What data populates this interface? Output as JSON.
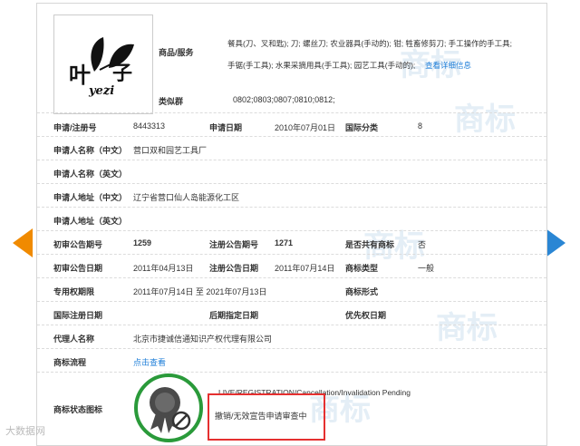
{
  "logo": {
    "chinese_left": "叶",
    "chinese_right": "子",
    "latin": "yezi"
  },
  "goods": {
    "label": "商品/服务",
    "line1": "餐具(刀、叉和匙); 刀; 螺丝刀; 农业器具(手动的); 钳; 牲畜修剪刀; 手工操作的手工具;",
    "line2": "手锯(手工具); 水果采摘用具(手工具); 园艺工具(手动的);",
    "detail_link": "查看详细信息"
  },
  "similar_group": {
    "label": "类似群",
    "value": "0802;0803;0807;0810;0812;"
  },
  "rows": {
    "reg_no_label": "申请/注册号",
    "reg_no": "8443313",
    "app_date_label": "申请日期",
    "app_date": "2010年07月01日",
    "intl_class_label": "国际分类",
    "intl_class": "8",
    "applicant_cn_label": "申请人名称（中文）",
    "applicant_cn": "营口双和园艺工具厂",
    "applicant_en_label": "申请人名称（英文）",
    "address_cn_label": "申请人地址（中文）",
    "address_cn": "辽宁省营口仙人岛能源化工区",
    "address_en_label": "申请人地址（英文）",
    "prelim_no_label": "初审公告期号",
    "prelim_no": "1259",
    "reg_pub_no_label": "注册公告期号",
    "reg_pub_no": "1271",
    "shared_label": "是否共有商标",
    "shared": "否",
    "prelim_date_label": "初审公告日期",
    "prelim_date": "2011年04月13日",
    "reg_pub_date_label": "注册公告日期",
    "reg_pub_date": "2011年07月14日",
    "tm_type_label": "商标类型",
    "tm_type": "一般",
    "exclusive_label": "专用权期限",
    "exclusive": "2011年07月14日 至 2021年07月13日",
    "tm_form_label": "商标形式",
    "intl_reg_date_label": "国际注册日期",
    "later_date_label": "后期指定日期",
    "priority_label": "优先权日期",
    "agent_label": "代理人名称",
    "agent": "北京市捷诚信通知识产权代理有限公司",
    "flow_label": "商标流程",
    "flow_link": "点击查看",
    "status_label": "商标状态图标",
    "status_en": "LIVE/REGISTRATION/Cancellation/Invalidation Pending",
    "status_cn": "撤销/无效宣告申请审查中"
  },
  "watermark": {
    "text": "商标",
    "footer": "大数据网"
  },
  "colors": {
    "accent_orange": "#f08a00",
    "accent_blue": "#2a86d4",
    "link": "#1e7ed8",
    "highlight_red": "#e53030",
    "seal_green": "#2a9a3a"
  }
}
